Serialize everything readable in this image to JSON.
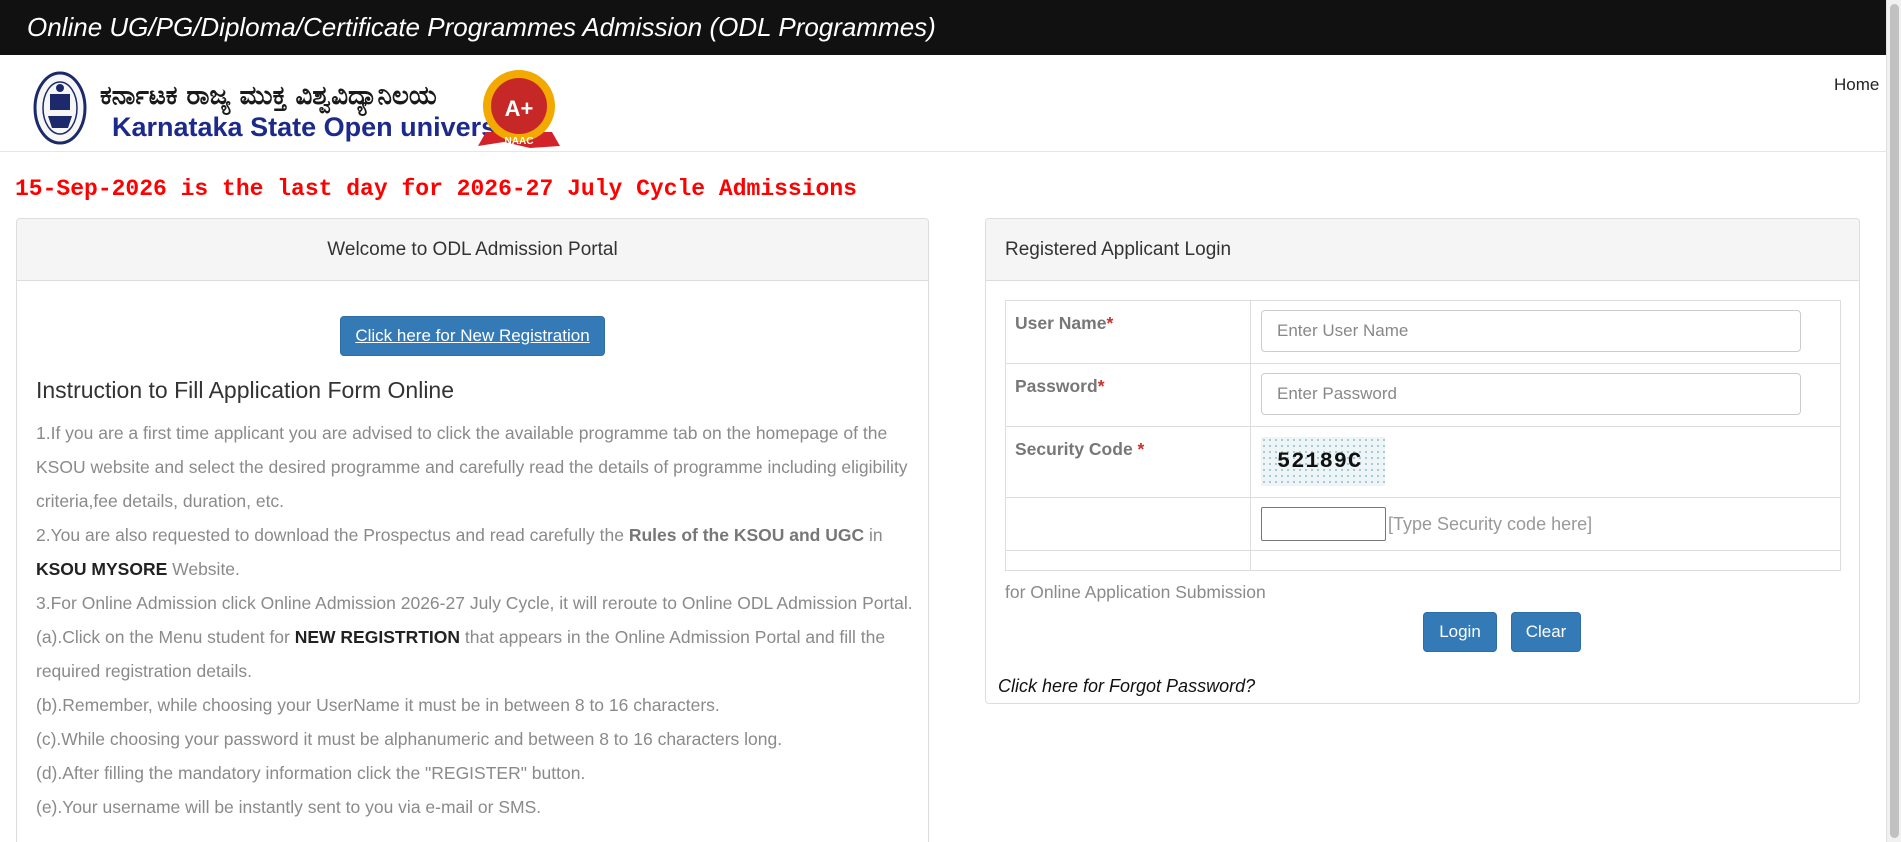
{
  "topbar": {
    "title": "Online UG/PG/Diploma/Certificate Programmes Admission (ODL Programmes)"
  },
  "header": {
    "logo": {
      "kannada_name": "ಕರ್ನಾಟಕ ರಾಜ್ಯ ಮುಕ್ತ ವಿಶ್ವವಿದ್ಯಾನಿಲಯ",
      "english_name": "Karnataka State Open university",
      "naac_grade": "A+",
      "naac_label": "NAAC"
    },
    "nav_home": "Home"
  },
  "notice": "15-Sep-2026 is the last day for 2026-27 July Cycle Admissions",
  "welcome_panel": {
    "heading": "Welcome to ODL Admission Portal",
    "new_registration_button": "Click here for New Registration",
    "instructions_title": "Instruction to Fill Application Form Online",
    "instructions": {
      "p1": "1.If you are a first time applicant you are advised to click the available programme tab on the homepage of the KSOU website and select the desired programme and carefully read the details of programme including eligibility criteria,fee details, duration, etc.",
      "p2_a": "2.You are also requested to download the Prospectus and read carefully the ",
      "p2_b": "Rules of the KSOU and UGC",
      "p2_c": " in ",
      "p2_d": "KSOU MYSORE",
      "p2_e": " Website.",
      "p3": "3.For Online Admission click Online Admission 2026-27 July Cycle, it will reroute to Online ODL Admission Portal.",
      "pa_1": "(a).Click on the Menu student for ",
      "pa_2": "NEW REGISTRTION",
      "pa_3": " that appears in the Online Admission Portal and fill the required registration details.",
      "pb": "(b).Remember, while choosing your UserName it must be in between 8 to 16 characters.",
      "pc": "(c).While choosing your password it must be alphanumeric and between 8 to 16 characters long.",
      "pd": "(d).After filling the mandatory information click the \"REGISTER\" button.",
      "pe": "(e).Your username will be instantly sent to you via e-mail or SMS."
    }
  },
  "login_panel": {
    "heading": "Registered Applicant Login",
    "username_label": "User Name",
    "username_placeholder": "Enter User Name",
    "password_label": "Password",
    "password_placeholder": "Enter Password",
    "security_label": "Security Code ",
    "required_mark": "*",
    "captcha_code": "52189C",
    "captcha_hint": "[Type Security code here]",
    "submission_text": "for Online Application Submission",
    "login_button": "Login",
    "clear_button": "Clear",
    "forgot_password": "Click here for Forgot Password?"
  },
  "colors": {
    "topbar_bg": "#111111",
    "notice_red": "#ff0000",
    "primary_button": "#337ab7",
    "required_red": "#c9302c"
  }
}
